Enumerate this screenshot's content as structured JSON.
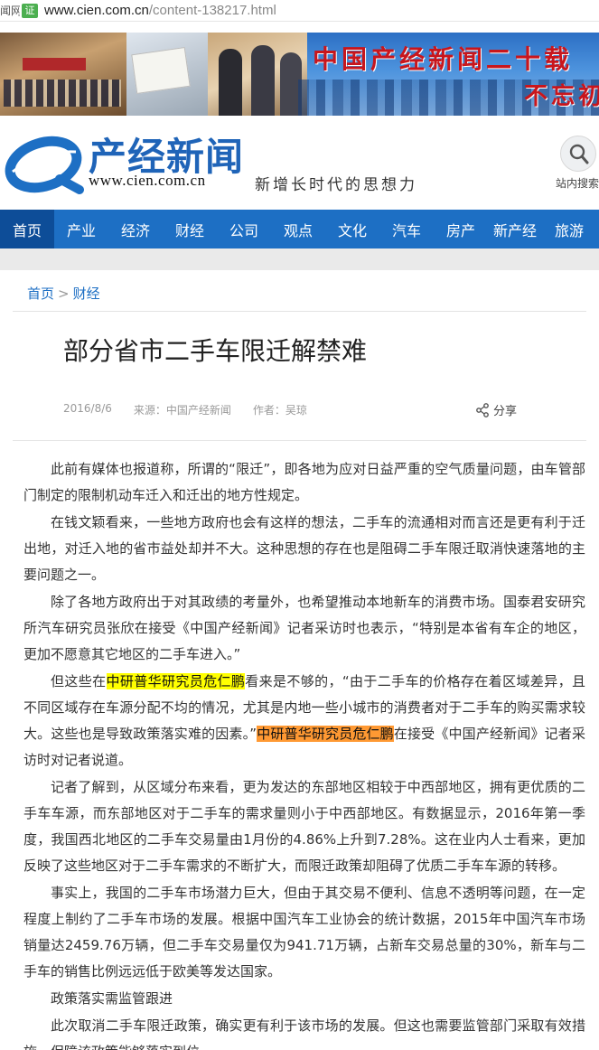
{
  "address_bar": {
    "site_label": "闻网",
    "cert_label": "证",
    "url_host": "www.cien.com.cn",
    "url_path": "/content-138217.html"
  },
  "banner": {
    "slogan_line1": "中国产经新闻二十载",
    "slogan_line2": "不忘初"
  },
  "header": {
    "logo_title": "产经新闻",
    "logo_url": "www.cien.com.cn",
    "tagline": "新增长时代的思想力",
    "search_label": "站内搜索"
  },
  "nav": {
    "items": [
      "首页",
      "产业",
      "经济",
      "财经",
      "公司",
      "观点",
      "文化",
      "汽车",
      "房产",
      "新产经",
      "旅游"
    ]
  },
  "breadcrumb": {
    "home": "首页",
    "separator": ">",
    "section": "财经"
  },
  "article": {
    "title": "部分省市二手车限迁解禁难",
    "date": "2016/8/6",
    "source": "来源：中国产经新闻",
    "author": "作者：吴琼",
    "share_label": "分享",
    "p1": "此前有媒体也报道称，所谓的“限迁”，即各地为应对日益严重的空气质量问题，由车管部门制定的限制机动车迁入和迁出的地方性规定。",
    "p2": "在钱文颖看来，一些地方政府也会有这样的想法，二手车的流通相对而言还是更有利于迁出地，对迁入地的省市益处却并不大。这种思想的存在也是阻碍二手车限迁取消快速落地的主要问题之一。",
    "p3": "除了各地方政府出于对其政绩的考量外，也希望推动本地新车的消费市场。国泰君安研究所汽车研究员张欣在接受《中国产经新闻》记者采访时也表示，“特别是本省有车企的地区，更加不愿意其它地区的二手车进入。”",
    "p4_a": "但这些在",
    "p4_hl1": "中研普华研究员危仁鹏",
    "p4_b": "看来是不够的，“由于二手车的价格存在着区域差异，且不同区域存在车源分配不均的情况，尤其是内地一些小城市的消费者对于二手车的购买需求较大。这些也是导致政策落实难的因素。”",
    "p4_hl2": "中研普华研究员危仁鹏",
    "p4_c": "在接受《中国产经新闻》记者采访时对记者说道。",
    "p5": "记者了解到，从区域分布来看，更为发达的东部地区相较于中西部地区，拥有更优质的二手车车源，而东部地区对于二手车的需求量则小于中西部地区。有数据显示，2016年第一季度，我国西北地区的二手车交易量由1月份的4.86%上升到7.28%。这在业内人士看来，更加反映了这些地区对于二手车需求的不断扩大，而限迁政策却阻碍了优质二手车车源的转移。",
    "p6": "事实上，我国的二手车市场潜力巨大，但由于其交易不便利、信息不透明等问题，在一定程度上制约了二手车市场的发展。根据中国汽车工业协会的统计数据，2015年中国汽车市场销量达2459.76万辆，但二手车交易量仅为941.71万辆，占新车交易总量的30%，新车与二手车的销售比例远远低于欧美等发达国家。",
    "p7": "政策落实需监管跟进",
    "p8": "此次取消二手车限迁政策，确实更有利于该市场的发展。但这也需要监管部门采取有效措施，保障该政策能够落实到位。"
  },
  "colors": {
    "brand_blue": "#1d6fc4",
    "nav_active": "#0d4d98",
    "slogan_red": "#c8161d",
    "highlight_yellow": "#ffff00",
    "highlight_orange": "#ff9933"
  }
}
